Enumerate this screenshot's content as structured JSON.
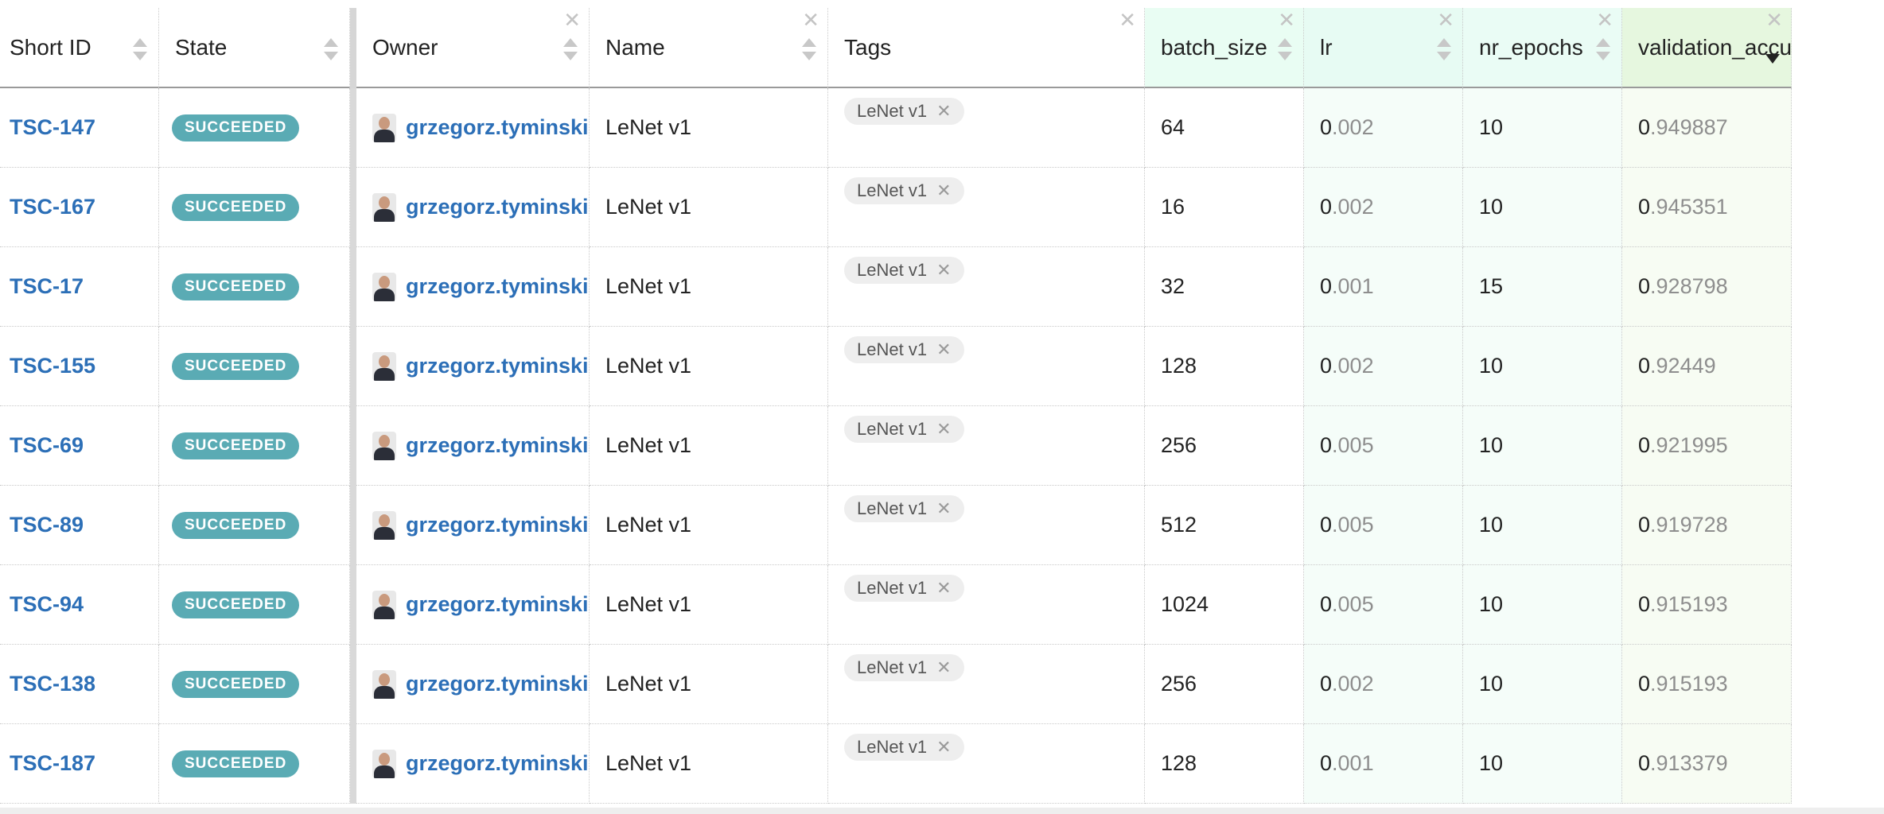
{
  "columns": {
    "short_id": "Short ID",
    "state": "State",
    "owner": "Owner",
    "name": "Name",
    "tags": "Tags",
    "batch_size": "batch_size",
    "lr": "lr",
    "nr_epochs": "nr_epochs",
    "validation_accuracy": "validation_accuracy"
  },
  "close_glyph": "✕",
  "colors": {
    "parameter_header": "#e9fdf3",
    "metric_header": "#e6f7df",
    "link": "#2c6fb7",
    "state_badge": "#5aabb4"
  },
  "sort": {
    "column": "validation_accuracy",
    "direction": "descending"
  },
  "rows": [
    {
      "id": "TSC-147",
      "state": "SUCCEEDED",
      "owner": "grzegorz.tyminski",
      "name": "LeNet v1",
      "tag": "LeNet v1",
      "batch_size": "64",
      "lr_int": "0",
      "lr_frac": ".002",
      "epochs": "10",
      "acc_int": "0",
      "acc_frac": ".949887"
    },
    {
      "id": "TSC-167",
      "state": "SUCCEEDED",
      "owner": "grzegorz.tyminski",
      "name": "LeNet v1",
      "tag": "LeNet v1",
      "batch_size": "16",
      "lr_int": "0",
      "lr_frac": ".002",
      "epochs": "10",
      "acc_int": "0",
      "acc_frac": ".945351"
    },
    {
      "id": "TSC-17",
      "state": "SUCCEEDED",
      "owner": "grzegorz.tyminski",
      "name": "LeNet v1",
      "tag": "LeNet v1",
      "batch_size": "32",
      "lr_int": "0",
      "lr_frac": ".001",
      "epochs": "15",
      "acc_int": "0",
      "acc_frac": ".928798"
    },
    {
      "id": "TSC-155",
      "state": "SUCCEEDED",
      "owner": "grzegorz.tyminski",
      "name": "LeNet v1",
      "tag": "LeNet v1",
      "batch_size": "128",
      "lr_int": "0",
      "lr_frac": ".002",
      "epochs": "10",
      "acc_int": "0",
      "acc_frac": ".92449"
    },
    {
      "id": "TSC-69",
      "state": "SUCCEEDED",
      "owner": "grzegorz.tyminski",
      "name": "LeNet v1",
      "tag": "LeNet v1",
      "batch_size": "256",
      "lr_int": "0",
      "lr_frac": ".005",
      "epochs": "10",
      "acc_int": "0",
      "acc_frac": ".921995"
    },
    {
      "id": "TSC-89",
      "state": "SUCCEEDED",
      "owner": "grzegorz.tyminski",
      "name": "LeNet v1",
      "tag": "LeNet v1",
      "batch_size": "512",
      "lr_int": "0",
      "lr_frac": ".005",
      "epochs": "10",
      "acc_int": "0",
      "acc_frac": ".919728"
    },
    {
      "id": "TSC-94",
      "state": "SUCCEEDED",
      "owner": "grzegorz.tyminski",
      "name": "LeNet v1",
      "tag": "LeNet v1",
      "batch_size": "1024",
      "lr_int": "0",
      "lr_frac": ".005",
      "epochs": "10",
      "acc_int": "0",
      "acc_frac": ".915193"
    },
    {
      "id": "TSC-138",
      "state": "SUCCEEDED",
      "owner": "grzegorz.tyminski",
      "name": "LeNet v1",
      "tag": "LeNet v1",
      "batch_size": "256",
      "lr_int": "0",
      "lr_frac": ".002",
      "epochs": "10",
      "acc_int": "0",
      "acc_frac": ".915193"
    },
    {
      "id": "TSC-187",
      "state": "SUCCEEDED",
      "owner": "grzegorz.tyminski",
      "name": "LeNet v1",
      "tag": "LeNet v1",
      "batch_size": "128",
      "lr_int": "0",
      "lr_frac": ".001",
      "epochs": "10",
      "acc_int": "0",
      "acc_frac": ".913379"
    }
  ]
}
